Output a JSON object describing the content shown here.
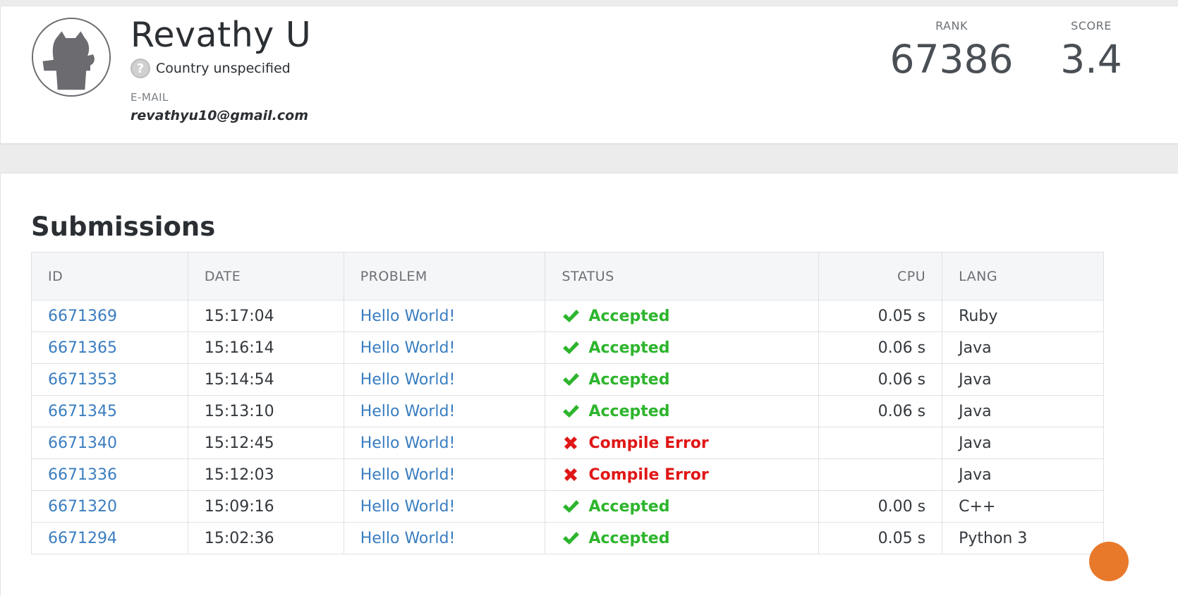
{
  "profile": {
    "name": "Revathy U",
    "country": "Country unspecified",
    "country_icon": "question-mark-icon",
    "email_label": "E-MAIL",
    "email": "revathyu10@gmail.com",
    "rank_label": "RANK",
    "rank_value": "67386",
    "score_label": "SCORE",
    "score_value": "3.4"
  },
  "submissions": {
    "title": "Submissions",
    "columns": {
      "id": "ID",
      "date": "DATE",
      "problem": "PROBLEM",
      "status": "STATUS",
      "cpu": "CPU",
      "lang": "LANG"
    },
    "rows": [
      {
        "id": "6671369",
        "date": "15:17:04",
        "problem": "Hello World!",
        "status": "Accepted",
        "ok": true,
        "cpu": "0.05 s",
        "lang": "Ruby"
      },
      {
        "id": "6671365",
        "date": "15:16:14",
        "problem": "Hello World!",
        "status": "Accepted",
        "ok": true,
        "cpu": "0.06 s",
        "lang": "Java"
      },
      {
        "id": "6671353",
        "date": "15:14:54",
        "problem": "Hello World!",
        "status": "Accepted",
        "ok": true,
        "cpu": "0.06 s",
        "lang": "Java"
      },
      {
        "id": "6671345",
        "date": "15:13:10",
        "problem": "Hello World!",
        "status": "Accepted",
        "ok": true,
        "cpu": "0.06 s",
        "lang": "Java"
      },
      {
        "id": "6671340",
        "date": "15:12:45",
        "problem": "Hello World!",
        "status": "Compile Error",
        "ok": false,
        "cpu": "",
        "lang": "Java"
      },
      {
        "id": "6671336",
        "date": "15:12:03",
        "problem": "Hello World!",
        "status": "Compile Error",
        "ok": false,
        "cpu": "",
        "lang": "Java"
      },
      {
        "id": "6671320",
        "date": "15:09:16",
        "problem": "Hello World!",
        "status": "Accepted",
        "ok": true,
        "cpu": "0.00 s",
        "lang": "C++"
      },
      {
        "id": "6671294",
        "date": "15:02:36",
        "problem": "Hello World!",
        "status": "Accepted",
        "ok": true,
        "cpu": "0.05 s",
        "lang": "Python 3"
      }
    ]
  },
  "colors": {
    "accepted": "#2db52d",
    "error": "#e01717",
    "link": "#3a7dc0",
    "help_bubble": "#e8792b"
  }
}
